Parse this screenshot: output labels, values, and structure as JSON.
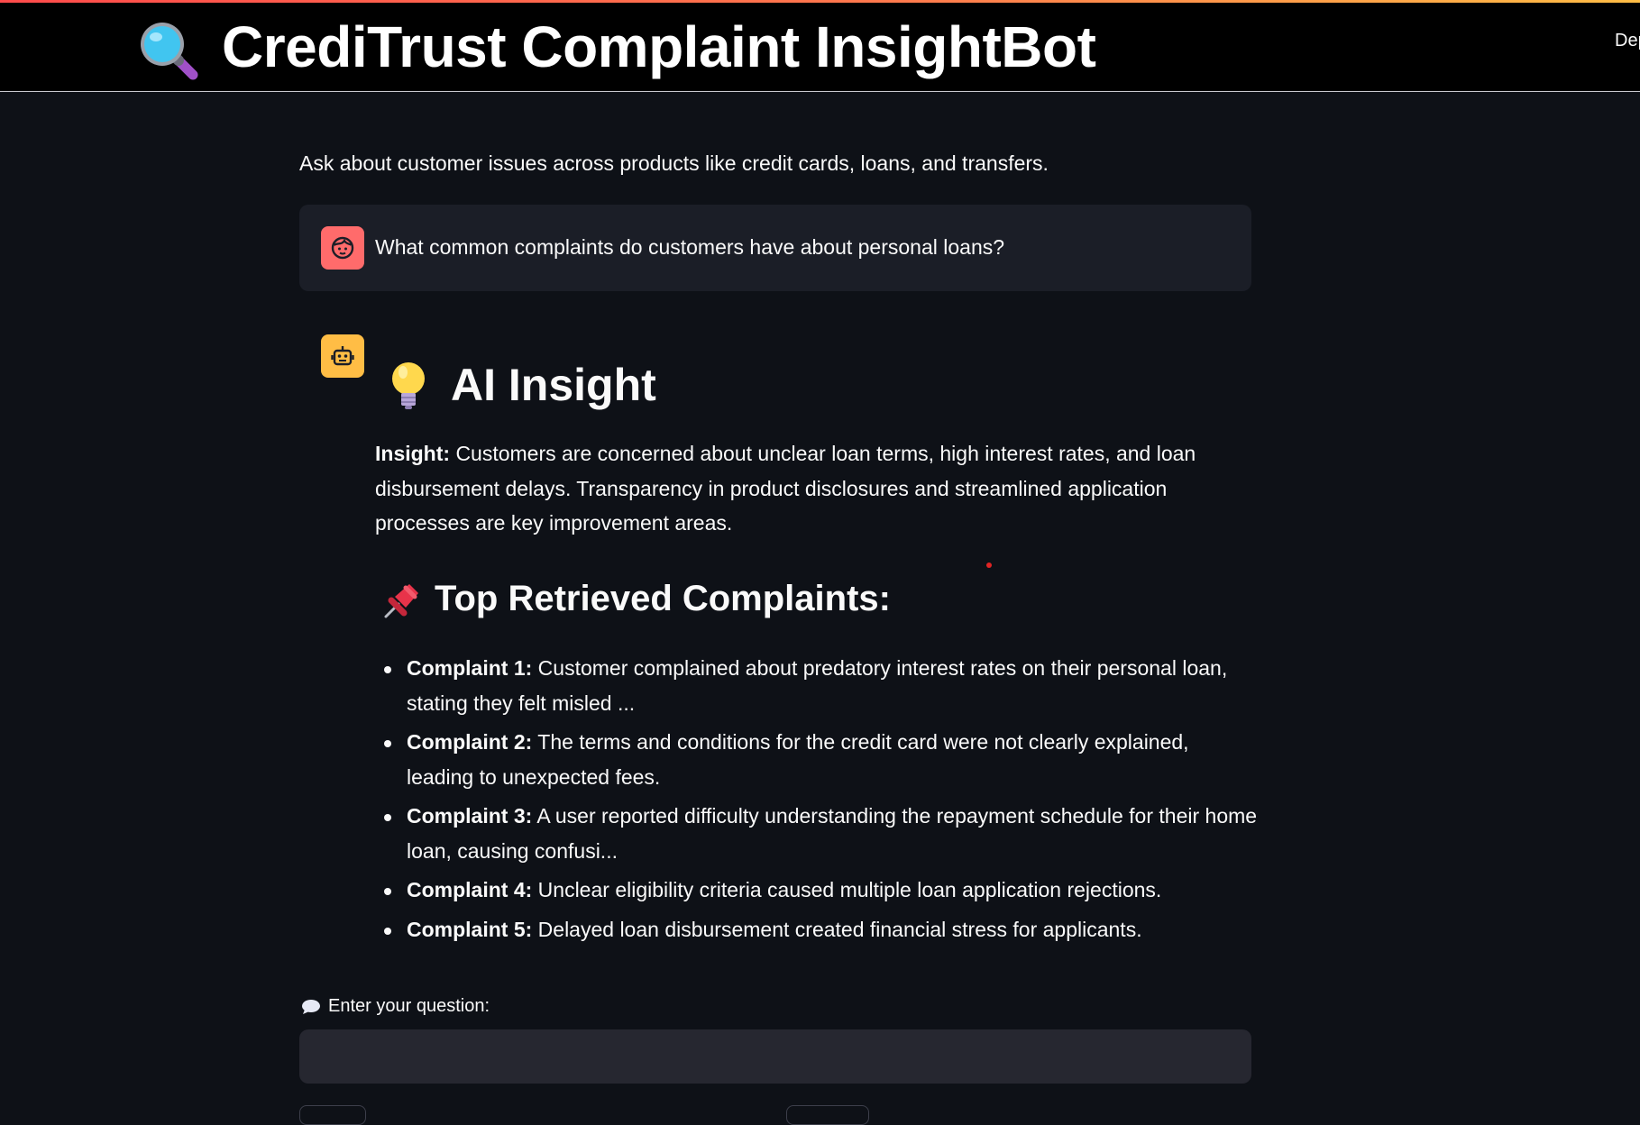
{
  "app": {
    "title": "CrediTrust Complaint InsightBot",
    "title_icon": "magnifying-glass-icon",
    "deploy_label": "Dep",
    "accent_colors": [
      "#ff4b4b",
      "#ffbd45"
    ]
  },
  "intro": "Ask about customer issues across products like credit cards, loans, and transfers.",
  "chat": {
    "user_message": "What common complaints do customers have about personal loans?",
    "user_avatar_icon": "user-face-icon",
    "bot_avatar_icon": "robot-icon",
    "insight_heading": "AI Insight",
    "insight_label": "Insight:",
    "insight_text": "Customers are concerned about unclear loan terms, high interest rates, and loan disbursement delays. Transparency in product disclosures and streamlined application processes are key improvement areas.",
    "complaints_heading": "Top Retrieved Complaints:",
    "complaints": [
      {
        "label": "Complaint 1:",
        "text": "Customer complained about predatory interest rates on their personal loan, stating they felt misled ..."
      },
      {
        "label": "Complaint 2:",
        "text": "The terms and conditions for the credit card were not clearly explained, leading to unexpected fees."
      },
      {
        "label": "Complaint 3:",
        "text": "A user reported difficulty understanding the repayment schedule for their home loan, causing confusi..."
      },
      {
        "label": "Complaint 4:",
        "text": "Unclear eligibility criteria caused multiple loan application rejections."
      },
      {
        "label": "Complaint 5:",
        "text": "Delayed loan disbursement created financial stress for applicants."
      }
    ]
  },
  "question": {
    "label": "Enter your question:",
    "value": ""
  }
}
